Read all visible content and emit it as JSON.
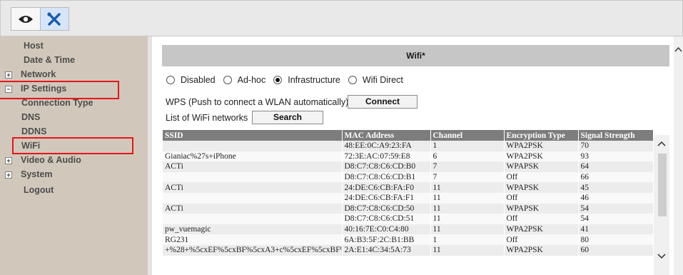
{
  "toolbar": {
    "buttons": [
      {
        "icon": "eye-icon",
        "active": false
      },
      {
        "icon": "wrench-screwdriver-icon",
        "active": true
      }
    ]
  },
  "sidebar": {
    "items": [
      {
        "label": "Host"
      },
      {
        "label": "Date & Time"
      },
      {
        "label": "Network",
        "expander": "+"
      },
      {
        "label": "IP Settings",
        "expander": "−",
        "highlighted": true
      },
      {
        "label": "Connection Type"
      },
      {
        "label": "DNS"
      },
      {
        "label": "DDNS"
      },
      {
        "label": "WiFi",
        "highlighted": true
      },
      {
        "label": "Video & Audio",
        "expander": "+"
      },
      {
        "label": "System",
        "expander": "+"
      },
      {
        "label": "Logout"
      }
    ]
  },
  "wifi": {
    "header": "Wifi*",
    "modes": [
      {
        "label": "Disabled",
        "checked": false
      },
      {
        "label": "Ad-hoc",
        "checked": false
      },
      {
        "label": "Infrastructure",
        "checked": true
      },
      {
        "label": "Wifi Direct",
        "checked": false
      }
    ],
    "wps_label": "WPS (Push to connect a WLAN automatically)",
    "connect_label": "Connect",
    "list_label": "List of WiFi networks",
    "search_label": "Search",
    "table": {
      "columns": [
        "SSID",
        "MAC Address",
        "Channel",
        "Encryption Type",
        "Signal Strength"
      ],
      "rows": [
        [
          "",
          "48:EE:0C:A9:23:FA",
          "1",
          "WPA2PSK",
          "70"
        ],
        [
          "Gianiac%27s+iPhone",
          "72:3E:AC:07:59:E8",
          "6",
          "WPA2PSK",
          "93"
        ],
        [
          "ACTi",
          "D8:C7:C8:C6:CD:B0",
          "7",
          "WPAPSK",
          "64"
        ],
        [
          "",
          "D8:C7:C8:C6:CD:B1",
          "7",
          "Off",
          "66"
        ],
        [
          "ACTi",
          "24:DE:C6:CB:FA:F0",
          "11",
          "WPAPSK",
          "45"
        ],
        [
          "",
          "24:DE:C6:CB:FA:F1",
          "11",
          "Off",
          "46"
        ],
        [
          "ACTi",
          "D8:C7:C8:C6:CD:50",
          "11",
          "WPAPSK",
          "54"
        ],
        [
          "",
          "D8:C7:C8:C6:CD:51",
          "11",
          "Off",
          "54"
        ],
        [
          "pw_vuemagic",
          "40:16:7E:C0:C4:80",
          "11",
          "WPA2PSK",
          "41"
        ],
        [
          "RG231",
          "6A:B3:5F:2C:B1:BB",
          "1",
          "Off",
          "80"
        ],
        [
          "+%28+%5cxEF%5cxBF%5cxA3+c%5cxEF%5cxBF%",
          "2A:E1:4C:34:5A:73",
          "11",
          "WPA2PSK",
          "60"
        ]
      ]
    }
  }
}
